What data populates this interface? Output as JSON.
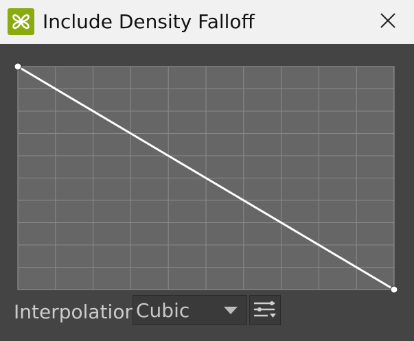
{
  "window": {
    "title": "Include Density Falloff",
    "app_icon": "butterfly-logo-icon",
    "close_icon": "close-icon"
  },
  "curve_editor": {
    "grid": true,
    "grid_columns": 10,
    "grid_rows": 10,
    "curve_points": [
      {
        "x": 0,
        "y": 1
      },
      {
        "x": 1,
        "y": 0
      }
    ],
    "colors": {
      "background": "#666666",
      "grid": "#8a8a8a",
      "curve": "#ffffff"
    }
  },
  "controls": {
    "interpolation_label": "Interpolation",
    "interpolation_value": "Cubic",
    "dropdown_icon": "chevron-down-icon",
    "settings_icon": "sliders-settings-icon"
  },
  "colors": {
    "titlebar": "#f1f1f1",
    "panel": "#444444",
    "accent": "#8aaa10"
  }
}
